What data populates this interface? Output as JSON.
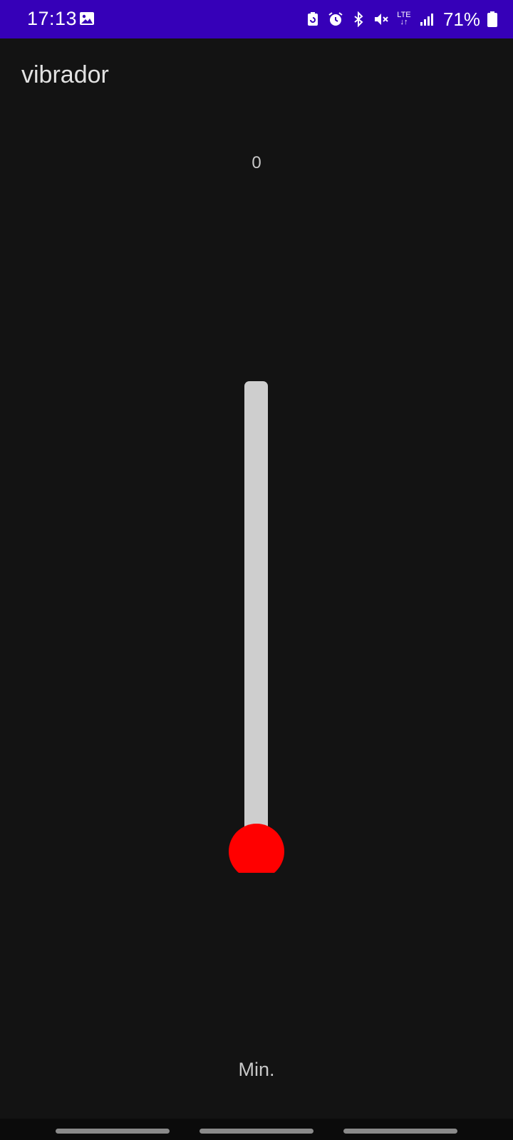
{
  "status_bar": {
    "time": "17:13",
    "lte_top": "LTE",
    "lte_bottom": "↓↑",
    "battery_percent": "71%",
    "icons": [
      "gallery-icon",
      "battery-saver-icon",
      "alarm-icon",
      "bluetooth-icon",
      "mute-icon",
      "lte-icon",
      "signal-icon",
      "battery-icon"
    ],
    "color": "#3600b8"
  },
  "app": {
    "title": "vibrador"
  },
  "slider": {
    "value": "0",
    "min_label": "Min.",
    "level": 0,
    "track_color": "#cecece",
    "thumb_color": "#ff0000"
  },
  "nav_bar": {
    "buttons": [
      "nav-recents",
      "nav-home",
      "nav-back"
    ]
  }
}
